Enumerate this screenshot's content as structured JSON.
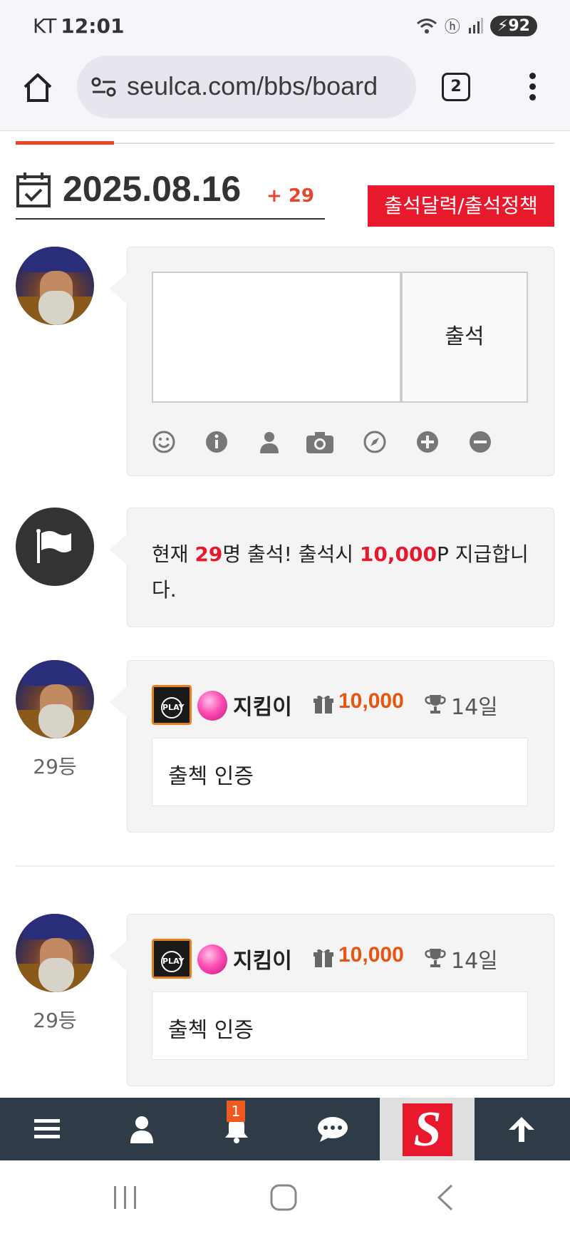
{
  "status_bar": {
    "carrier": "KT",
    "time": "12:01",
    "battery": "92"
  },
  "browser": {
    "url": "seulca.com/bbs/board",
    "tab_count": "2"
  },
  "header": {
    "date": "2025.08.16",
    "count_added": "+ 29",
    "policy_button": "출석달력/출석정책"
  },
  "write_form": {
    "submit_label": "출석"
  },
  "notice": {
    "prefix": "현재 ",
    "count": "29",
    "middle": "명 출석! 출석시 ",
    "points": "10,000",
    "suffix": "P 지급합니다."
  },
  "comments": [
    {
      "nickname": "지킴이",
      "points": "10,000",
      "days": "14일",
      "message": "출첵 인증",
      "rank": "29등",
      "badge": "PLAY"
    },
    {
      "nickname": "지킴이",
      "points": "10,000",
      "days": "14일",
      "message": "출첵 인증",
      "rank": "29등",
      "badge": "PLAY"
    }
  ],
  "bottom_nav": {
    "notification_count": "1",
    "logo": "S"
  },
  "colors": {
    "accent_red": "#e8192c",
    "points_orange": "#e8550f",
    "nav_bg": "#2f3b46"
  },
  "icons": [
    "home-icon",
    "site-settings-icon",
    "calendar-check-icon",
    "smile-icon",
    "info-icon",
    "user-icon",
    "camera-icon",
    "compass-icon",
    "plus-circle-icon",
    "minus-circle-icon",
    "flag-icon",
    "gift-icon",
    "trophy-icon",
    "menu-icon",
    "bell-icon",
    "chat-icon",
    "arrow-up-icon"
  ]
}
